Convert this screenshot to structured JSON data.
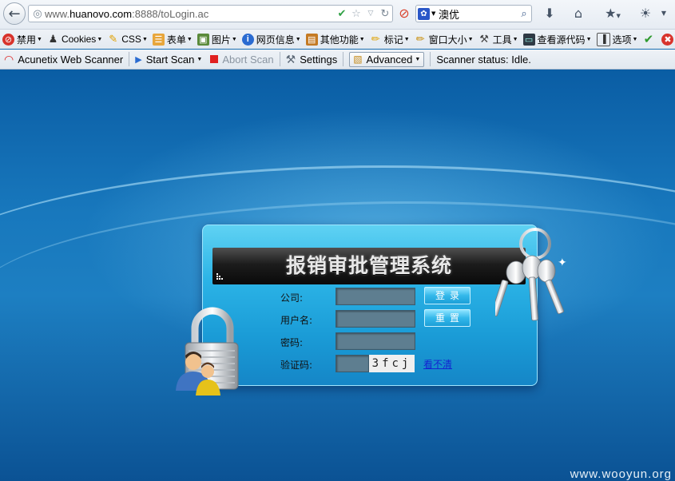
{
  "browser": {
    "url_prefix": "www.",
    "url_domain": "huanovo.com",
    "url_rest": ":8888/toLogin.ac",
    "search_value": "澳优"
  },
  "menubar": {
    "items": [
      {
        "label": "禁用",
        "icon": "disable-icon"
      },
      {
        "label": "Cookies",
        "icon": "cookies-icon"
      },
      {
        "label": "CSS",
        "icon": "css-pencil-icon"
      },
      {
        "label": "表单",
        "icon": "form-icon"
      },
      {
        "label": "图片",
        "icon": "image-icon"
      },
      {
        "label": "网页信息",
        "icon": "info-icon"
      },
      {
        "label": "其他功能",
        "icon": "misc-icon"
      },
      {
        "label": "标记",
        "icon": "outline-pencil-icon"
      },
      {
        "label": "窗口大小",
        "icon": "resize-icon"
      },
      {
        "label": "工具",
        "icon": "tools-icon"
      },
      {
        "label": "查看源代码",
        "icon": "source-icon"
      },
      {
        "label": "选项",
        "icon": "options-icon"
      }
    ]
  },
  "acunetix": {
    "title": "Acunetix Web Scanner",
    "start_scan": "Start Scan",
    "abort_scan": "Abort Scan",
    "settings": "Settings",
    "advanced": "Advanced",
    "status": "Scanner status: Idle."
  },
  "login": {
    "system_title": "报销审批管理系统",
    "company_label": "公司:",
    "username_label": "用户名:",
    "password_label": "密码:",
    "captcha_label": "验证码:",
    "captcha_text": "3fcj",
    "login_button": "登录",
    "reset_button": "重置",
    "refresh_link": "看不清"
  },
  "watermark": "www.wooyun.org",
  "colors": {
    "page_bg": "#1a70b3",
    "panel": "#2bb3e6",
    "title_band": "#1c1c1c",
    "field": "#5e7e90",
    "link": "#1424d0"
  }
}
